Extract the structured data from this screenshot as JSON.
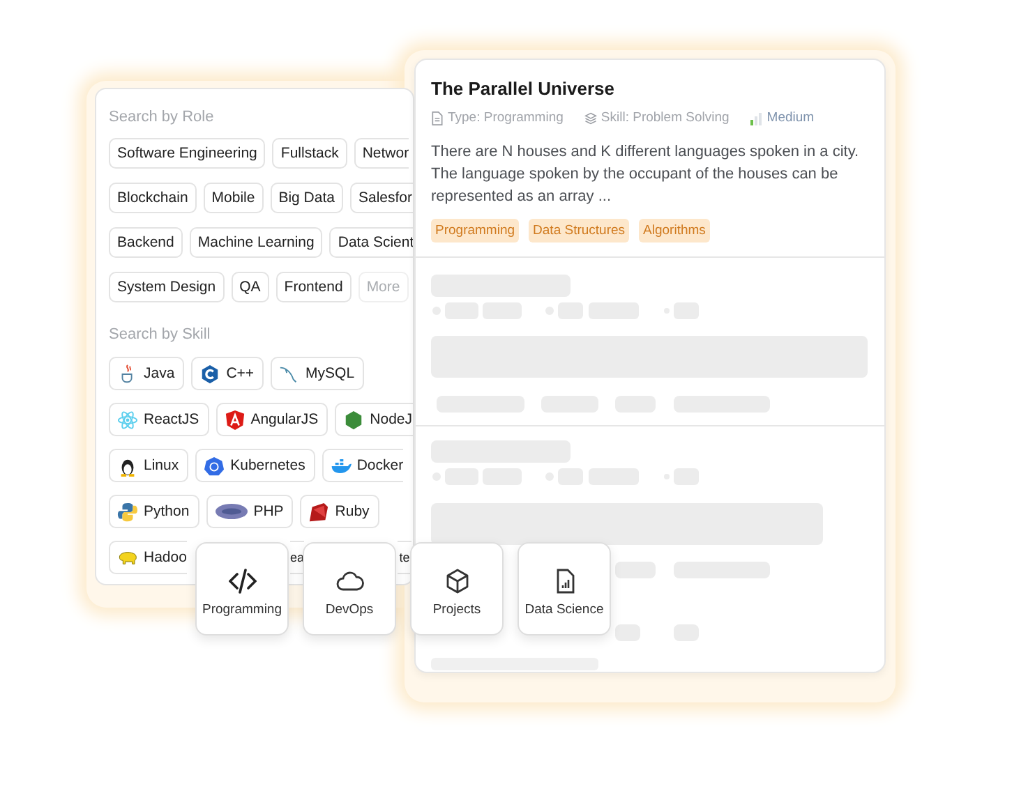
{
  "role_panel": {
    "heading": "Search by Role",
    "role_rows": [
      [
        {
          "label": "Software Engineering",
          "disabled": false,
          "open_right": false
        },
        {
          "label": "Fullstack",
          "disabled": false,
          "open_right": false
        },
        {
          "label": "Networ",
          "disabled": false,
          "open_right": true
        }
      ],
      [
        {
          "label": "Blockchain",
          "disabled": false,
          "open_right": false
        },
        {
          "label": "Mobile",
          "disabled": false,
          "open_right": false
        },
        {
          "label": "Big Data",
          "disabled": false,
          "open_right": false
        },
        {
          "label": "Salesfor",
          "disabled": false,
          "open_right": true
        }
      ],
      [
        {
          "label": "Backend",
          "disabled": false,
          "open_right": false
        },
        {
          "label": "Machine Learning",
          "disabled": false,
          "open_right": false
        },
        {
          "label": "Data Scient",
          "disabled": false,
          "open_right": true
        }
      ],
      [
        {
          "label": "System Design",
          "disabled": false,
          "open_right": false
        },
        {
          "label": "QA",
          "disabled": false,
          "open_right": false
        },
        {
          "label": "Frontend",
          "disabled": false,
          "open_right": false
        },
        {
          "label": "More",
          "disabled": true,
          "open_right": false
        }
      ]
    ],
    "skill_heading": "Search by Skill",
    "skill_rows": [
      [
        {
          "label": "Java",
          "open_left": false,
          "open_right": false
        },
        {
          "label": "C++",
          "open_left": false,
          "open_right": false
        },
        {
          "label": "MySQL",
          "open_left": false,
          "open_right": false
        }
      ],
      [
        {
          "label": "ReactJS",
          "open_left": false,
          "open_right": false
        },
        {
          "label": "AngularJS",
          "open_left": false,
          "open_right": false
        },
        {
          "label": "NodeJ",
          "open_left": false,
          "open_right": true
        }
      ],
      [
        {
          "label": "Linux",
          "open_left": false,
          "open_right": false
        },
        {
          "label": "Kubernetes",
          "open_left": false,
          "open_right": false
        },
        {
          "label": "Docker",
          "open_left": false,
          "open_right": true
        }
      ],
      [
        {
          "label": "Python",
          "open_left": false,
          "open_right": false
        },
        {
          "label": "PHP",
          "open_left": false,
          "open_right": false
        },
        {
          "label": "Ruby",
          "open_left": false,
          "open_right": false
        }
      ],
      [
        {
          "label": "Hadoo",
          "open_left": false,
          "open_right": true
        },
        {
          "label": "ea",
          "open_left": true,
          "open_right": true
        },
        {
          "label": "te",
          "open_left": true,
          "open_right": true
        }
      ]
    ]
  },
  "problem_card": {
    "title": "The Parallel Universe",
    "type": "Type: Programming",
    "skill": "Skill: Problem Solving",
    "difficulty": "Medium",
    "description": "There are N houses and K different languages spoken in a city. The language spoken by the occupant of the houses can be represented as an array ...",
    "tags": [
      "Programming",
      "Data Structures",
      "Algorithms"
    ]
  },
  "categories": [
    {
      "label": "Programming"
    },
    {
      "label": "DevOps"
    },
    {
      "label": "Projects"
    },
    {
      "label": "Data Science"
    }
  ]
}
